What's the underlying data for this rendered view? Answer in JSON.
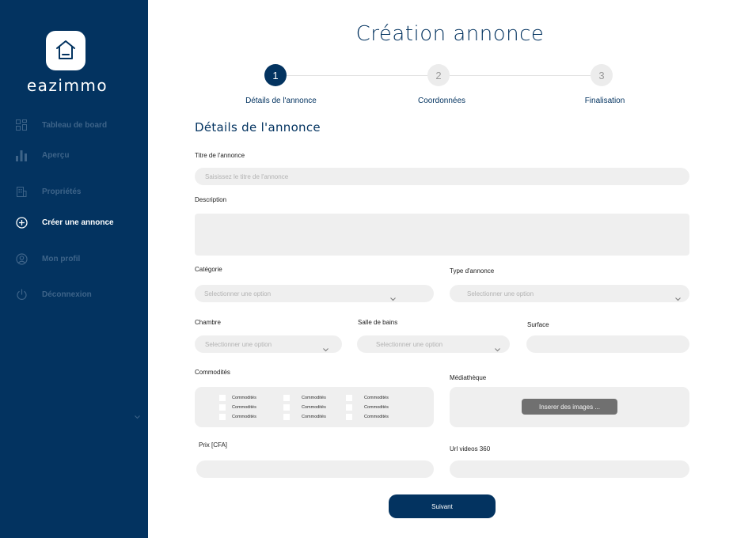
{
  "sidebar": {
    "logo_text": "eazimmo",
    "items": [
      {
        "label": "Tableau de board",
        "icon": "dashboard-grid-icon",
        "active": false
      },
      {
        "label": "Aperçu",
        "icon": "bar-chart-icon",
        "active": false
      },
      {
        "label": "Propriétés",
        "icon": "building-icon",
        "active": false
      },
      {
        "label": "Créer une annonce",
        "icon": "plus-circle-icon",
        "active": true
      },
      {
        "label": "Mon profil",
        "icon": "user-circle-icon",
        "active": false
      },
      {
        "label": "Déconnexion",
        "icon": "power-icon",
        "active": false
      }
    ]
  },
  "page": {
    "title": "Création annonce",
    "section_title": "Détails de l'annonce"
  },
  "steps": [
    {
      "number": "1",
      "label": "Détails de l'annonce",
      "active": true
    },
    {
      "number": "2",
      "label": "Coordonnées",
      "active": false
    },
    {
      "number": "3",
      "label": "Finalisation",
      "active": false
    }
  ],
  "form": {
    "title_label": "Titre de l'annonce",
    "title_placeholder": "Saisissez le titre de l'annonce",
    "description_label": "Description",
    "category_label": "Catégorie",
    "category_value": "Selectionner une option",
    "type_label": "Type d'annonce",
    "type_value": "Selectionner une option",
    "chambre_label": "Chambre",
    "chambre_value": "Selectionner une option",
    "salle_label": "Salle de bains",
    "salle_value": "Selectionner une option",
    "surface_label": "Surface",
    "commodites_label": "Commodités",
    "commodites_items": [
      "Commodités",
      "Commodités",
      "Commodités",
      "Commodités",
      "Commodités",
      "Commodités",
      "Commodités",
      "Commodités",
      "Commodités"
    ],
    "mediatheque_label": "Médiathèque",
    "insert_button": "Inserer des images ...",
    "prix_label": "Prix [CFA]",
    "url_label": "Url videos 360",
    "submit_button": "Suivant"
  },
  "colors": {
    "brand": "#033360",
    "field_bg": "#efefef",
    "inactive_nav": "#3e6489"
  }
}
